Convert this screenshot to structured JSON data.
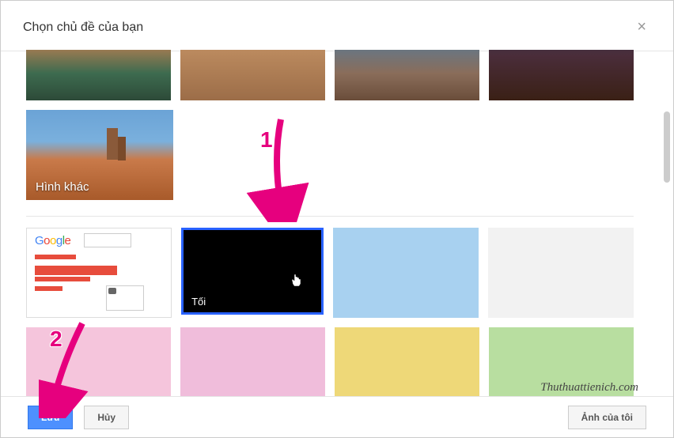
{
  "dialog": {
    "title": "Chọn chủ đề của bạn"
  },
  "images_section": {
    "more_label": "Hình khác"
  },
  "themes": {
    "dark_label": "Tối"
  },
  "footer": {
    "save_label": "Lưu",
    "cancel_label": "Hủy",
    "my_photos_label": "Ảnh của tôi"
  },
  "annotations": {
    "num1": "1",
    "num2": "2"
  },
  "watermark": "Thuthuattienich.com"
}
